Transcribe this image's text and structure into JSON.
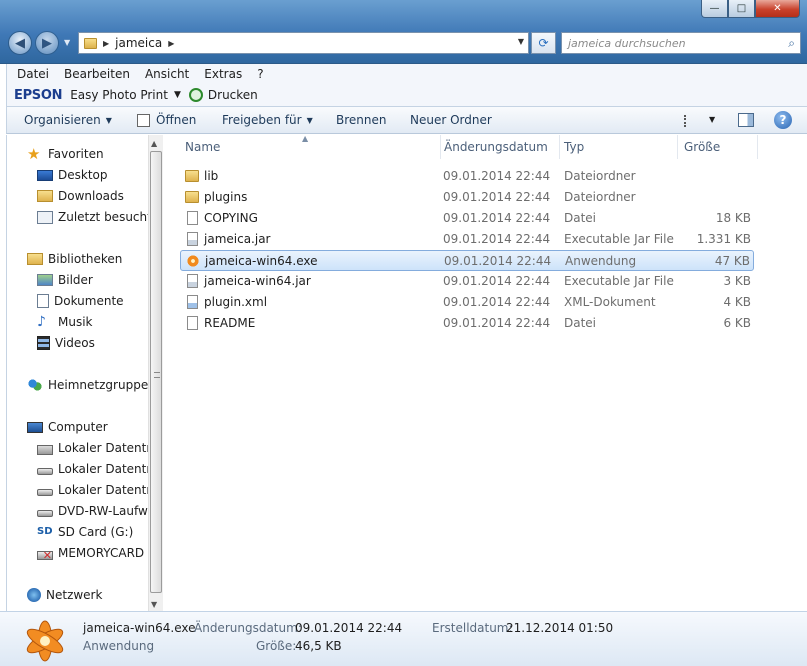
{
  "window": {
    "address": {
      "folder": "jameica"
    },
    "search_placeholder": "jameica durchsuchen",
    "controls": {
      "minimize": "—",
      "maximize": "□",
      "close": "✕"
    }
  },
  "menu": [
    "Datei",
    "Bearbeiten",
    "Ansicht",
    "Extras",
    "?"
  ],
  "epson": {
    "brand": "EPSON",
    "easy_photo_print": "Easy Photo Print",
    "print": "Drucken"
  },
  "toolbar": {
    "organize": "Organisieren",
    "open": "Öffnen",
    "share": "Freigeben für",
    "burn": "Brennen",
    "new_folder": "Neuer Ordner"
  },
  "nav": {
    "favorites": "Favoriten",
    "desktop": "Desktop",
    "downloads": "Downloads",
    "recent": "Zuletzt besucht",
    "libraries": "Bibliotheken",
    "pictures": "Bilder",
    "documents": "Dokumente",
    "music": "Musik",
    "videos": "Videos",
    "homegroup": "Heimnetzgruppe",
    "computer": "Computer",
    "drive1": "Lokaler Datenträ",
    "drive2": "Lokaler Datenträ",
    "drive3": "Lokaler Datenträ",
    "dvd": "DVD-RW-Laufwe",
    "sd": "SD Card (G:)",
    "memorycard": "MEMORYCARD (",
    "network": "Netzwerk"
  },
  "columns": {
    "name": "Name",
    "date": "Änderungsdatum",
    "type": "Typ",
    "size": "Größe"
  },
  "files": [
    {
      "name": "lib",
      "date": "09.01.2014 22:44",
      "type": "Dateiordner",
      "size": "",
      "icon": "folder-icon"
    },
    {
      "name": "plugins",
      "date": "09.01.2014 22:44",
      "type": "Dateiordner",
      "size": "",
      "icon": "folder-icon"
    },
    {
      "name": "COPYING",
      "date": "09.01.2014 22:44",
      "type": "Datei",
      "size": "18 KB",
      "icon": "file-icon"
    },
    {
      "name": "jameica.jar",
      "date": "09.01.2014 22:44",
      "type": "Executable Jar File",
      "size": "1.331 KB",
      "icon": "jar-icon"
    },
    {
      "name": "jameica-win64.exe",
      "date": "09.01.2014 22:44",
      "type": "Anwendung",
      "size": "47 KB",
      "icon": "app-star-icon"
    },
    {
      "name": "jameica-win64.jar",
      "date": "09.01.2014 22:44",
      "type": "Executable Jar File",
      "size": "3 KB",
      "icon": "jar-icon"
    },
    {
      "name": "plugin.xml",
      "date": "09.01.2014 22:44",
      "type": "XML-Dokument",
      "size": "4 KB",
      "icon": "xml-icon"
    },
    {
      "name": "README",
      "date": "09.01.2014 22:44",
      "type": "Datei",
      "size": "6 KB",
      "icon": "file-icon"
    }
  ],
  "details": {
    "name": "jameica-win64.exe",
    "type": "Anwendung",
    "modified_label": "Änderungsdatum:",
    "modified": "09.01.2014 22:44",
    "created_label": "Erstelldatum:",
    "created": "21.12.2014 01:50",
    "size_label": "Größe:",
    "size": "46,5 KB"
  }
}
